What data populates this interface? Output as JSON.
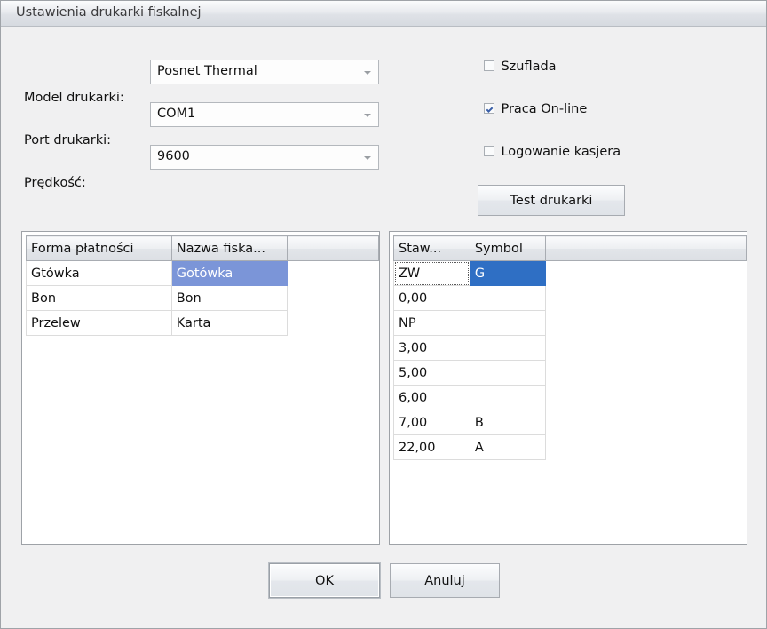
{
  "window": {
    "title": "Ustawienia drukarki fiskalnej"
  },
  "form": {
    "fields": [
      {
        "label": "Model drukarki:",
        "value": "Posnet Thermal",
        "arrow_icon": "chevron-down-icon"
      },
      {
        "label": "Port drukarki:",
        "value": "COM1",
        "arrow_icon": "chevron-down-icon"
      },
      {
        "label": "Prędkość:",
        "value": "9600",
        "arrow_icon": "chevron-down-icon"
      }
    ]
  },
  "options": {
    "checkboxes": [
      {
        "label": "Szuflada",
        "checked": false
      },
      {
        "label": "Praca On-line",
        "checked": true
      },
      {
        "label": "Logowanie kasjera",
        "checked": false
      }
    ],
    "test_button": "Test drukarki"
  },
  "payment_table": {
    "headers": [
      "Forma płatności",
      "Nazwa fiska...",
      ""
    ],
    "rows": [
      {
        "cells": [
          "Gtówka",
          "Gotówka"
        ],
        "selected_col": 1
      },
      {
        "cells": [
          "Bon",
          "Bon"
        ],
        "selected_col": -1
      },
      {
        "cells": [
          "Przelew",
          "Karta"
        ],
        "selected_col": -1
      }
    ]
  },
  "vat_table": {
    "headers": [
      "Staw...",
      "Symbol",
      ""
    ],
    "rows": [
      {
        "cells": [
          "ZW",
          "G"
        ],
        "selected_col": 1,
        "focus_col": 0
      },
      {
        "cells": [
          "0,00",
          ""
        ],
        "selected_col": -1,
        "focus_col": -1
      },
      {
        "cells": [
          "NP",
          ""
        ],
        "selected_col": -1,
        "focus_col": -1
      },
      {
        "cells": [
          "3,00",
          ""
        ],
        "selected_col": -1,
        "focus_col": -1
      },
      {
        "cells": [
          "5,00",
          ""
        ],
        "selected_col": -1,
        "focus_col": -1
      },
      {
        "cells": [
          "6,00",
          ""
        ],
        "selected_col": -1,
        "focus_col": -1
      },
      {
        "cells": [
          "7,00",
          "B"
        ],
        "selected_col": -1,
        "focus_col": -1
      },
      {
        "cells": [
          "22,00",
          "A"
        ],
        "selected_col": -1,
        "focus_col": -1
      }
    ]
  },
  "footer": {
    "ok": "OK",
    "cancel": "Anuluj"
  },
  "colors": {
    "selection_active": "#2f6fc4",
    "selection_inactive": "#7b95d8",
    "window_bg": "#f0f0f1",
    "panel_bg": "#ffffff"
  }
}
